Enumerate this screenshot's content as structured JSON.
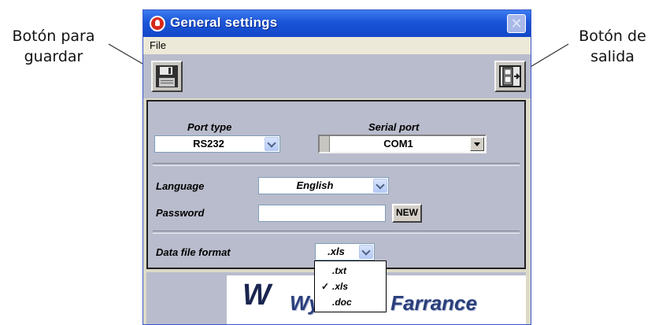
{
  "annotations": {
    "left": [
      "Botón para",
      "guardar"
    ],
    "right": [
      "Botón de",
      "salida"
    ]
  },
  "window": {
    "title": "General settings",
    "close_icon": "close-icon"
  },
  "menu": {
    "file_label": "File"
  },
  "toolbar": {
    "save_icon": "floppy-disk-icon",
    "exit_icon": "exit-door-icon"
  },
  "settings": {
    "port_type_label": "Port type",
    "port_type_value": "RS232",
    "serial_port_label": "Serial port",
    "serial_port_value": "COM1",
    "language_label": "Language",
    "language_value": "English",
    "password_label": "Password",
    "password_value": "",
    "new_button_label": "NEW",
    "data_file_format_label": "Data file format",
    "data_file_format_value": ".xls"
  },
  "format_dropdown": {
    "options": [
      {
        "label": ".txt",
        "checked": ""
      },
      {
        "label": ".xls",
        "checked": "✓"
      },
      {
        "label": ".doc",
        "checked": ""
      }
    ]
  },
  "logo": {
    "mark": "W",
    "text_visible": "Wykeham Farrance"
  },
  "colors": {
    "title_bar": "#1b54d8",
    "panel_bg": "#b9bccc",
    "menu_bg": "#ece9d8"
  }
}
